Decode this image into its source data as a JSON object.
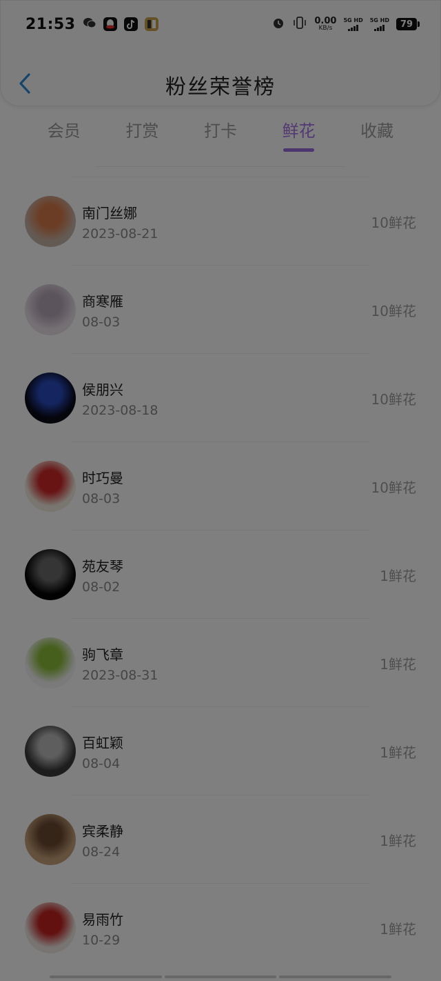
{
  "status_bar": {
    "time": "21:53",
    "net_speed_value": "0.00",
    "net_speed_unit": "KB/s",
    "sim1_label": "5G HD",
    "sim2_label": "5G HD",
    "battery": "79",
    "icons": [
      "wechat-icon",
      "qq-icon",
      "tiktok-icon",
      "game-app-icon",
      "alarm-icon",
      "vibrate-icon"
    ]
  },
  "header": {
    "title": "粉丝荣誉榜",
    "back_icon": "chevron-left-icon"
  },
  "tabs": [
    {
      "label": "会员",
      "active": false
    },
    {
      "label": "打赏",
      "active": false
    },
    {
      "label": "打卡",
      "active": false
    },
    {
      "label": "鲜花",
      "active": true
    },
    {
      "label": "收藏",
      "active": false
    }
  ],
  "list": [
    {
      "name": "南门丝娜",
      "date": "2023-08-21",
      "count": "10鲜花",
      "avatar_colors": [
        "#c9b5a8",
        "#d77a4a"
      ]
    },
    {
      "name": "商寒雁",
      "date": "08-03",
      "count": "10鲜花",
      "avatar_colors": [
        "#e8e0e8",
        "#b8a8b8"
      ]
    },
    {
      "name": "侯朋兴",
      "date": "2023-08-18",
      "count": "10鲜花",
      "avatar_colors": [
        "#0a0a18",
        "#2a4bc0"
      ]
    },
    {
      "name": "时巧曼",
      "date": "08-03",
      "count": "10鲜花",
      "avatar_colors": [
        "#f3ece0",
        "#d02828"
      ]
    },
    {
      "name": "苑友琴",
      "date": "08-02",
      "count": "1鲜花",
      "avatar_colors": [
        "#050505",
        "#6a6a6a"
      ]
    },
    {
      "name": "驹飞章",
      "date": "2023-08-31",
      "count": "1鲜花",
      "avatar_colors": [
        "#f4f4f4",
        "#8cbf3a"
      ]
    },
    {
      "name": "百虹颖",
      "date": "08-04",
      "count": "1鲜花",
      "avatar_colors": [
        "#3a3a3a",
        "#bdbdbd"
      ]
    },
    {
      "name": "宾柔静",
      "date": "08-24",
      "count": "1鲜花",
      "avatar_colors": [
        "#c8a27a",
        "#6b4a33"
      ]
    },
    {
      "name": "易雨竹",
      "date": "10-29",
      "count": "1鲜花",
      "avatar_colors": [
        "#efe9e4",
        "#c42020"
      ]
    }
  ],
  "colors": {
    "accent": "#a472e6",
    "overlay": "rgba(0,0,0,0.5)",
    "back_arrow": "#2a8ad6"
  }
}
